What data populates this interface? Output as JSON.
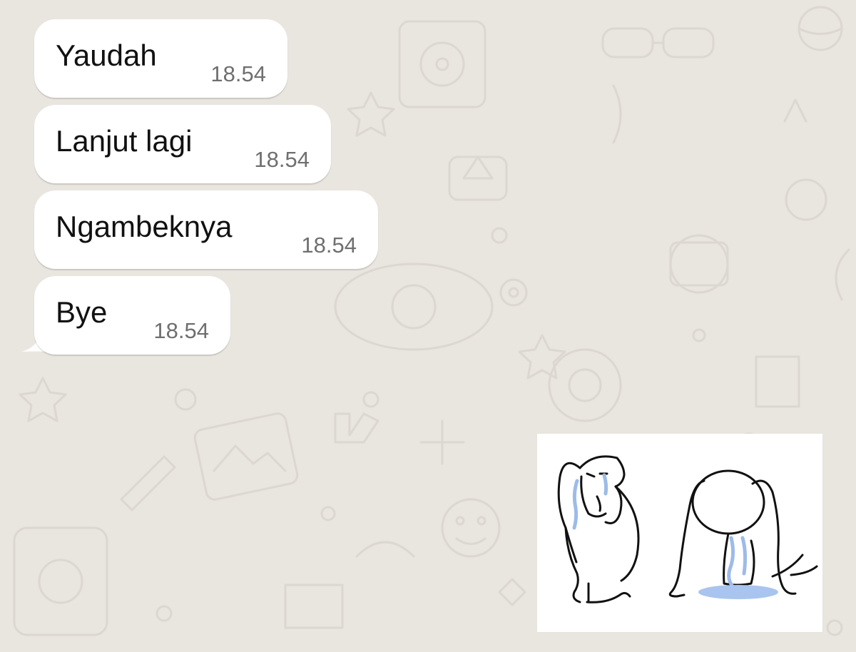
{
  "chat": {
    "messages": [
      {
        "text": "Yaudah",
        "time": "18.54"
      },
      {
        "text": "Lanjut lagi",
        "time": "18.54"
      },
      {
        "text": "Ngambeknya",
        "time": "18.54"
      },
      {
        "text": "Bye",
        "time": "18.54"
      }
    ],
    "sticker": {
      "icon": "crying-kneeling-figures-sticker"
    }
  },
  "colors": {
    "background": "#e9e5df",
    "bubble": "#ffffff",
    "text": "#111111",
    "timestamp": "#6f6f6f",
    "tears": "#9dbbe8"
  }
}
